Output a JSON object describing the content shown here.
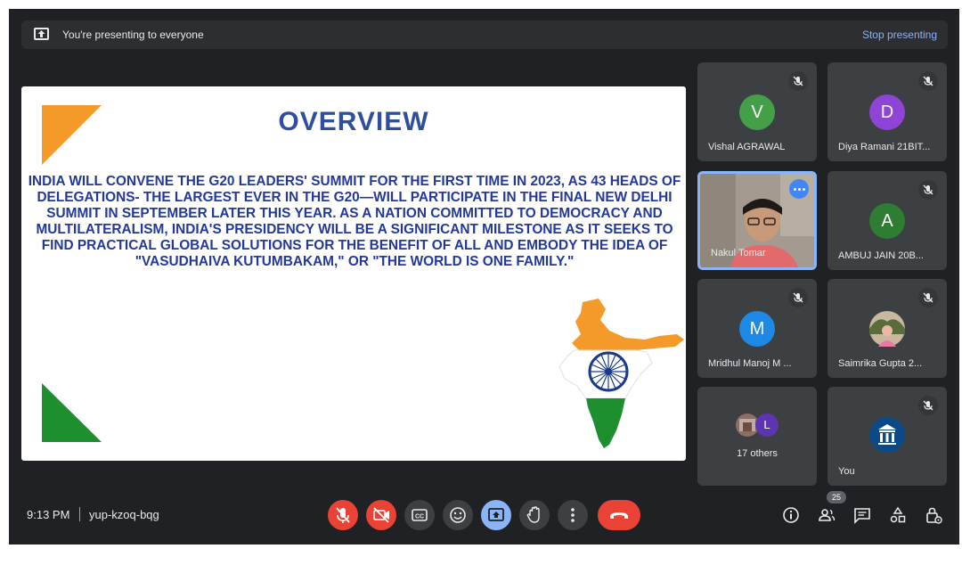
{
  "banner": {
    "text": "You're presenting to everyone",
    "stop_label": "Stop presenting",
    "icon": "present-icon"
  },
  "slide": {
    "title": "OVERVIEW",
    "body": "INDIA WILL CONVENE THE G20 LEADERS' SUMMIT FOR THE FIRST TIME IN 2023, AS 43 HEADS OF DELEGATIONS- THE LARGEST EVER IN THE G20—WILL PARTICIPATE IN THE FINAL NEW DELHI SUMMIT IN SEPTEMBER LATER THIS YEAR. AS A NATION COMMITTED TO DEMOCRACY AND MULTILATERALISM, INDIA'S PRESIDENCY WILL BE A SIGNIFICANT MILESTONE AS IT SEEKS TO FIND PRACTICAL GLOBAL SOLUTIONS FOR THE BENEFIT OF ALL AND EMBODY THE IDEA OF \"VASUDHAIVA KUTUMBAKAM,\" OR \"THE WORLD IS ONE FAMILY.\""
  },
  "participants": [
    {
      "name": "Vishal AGRAWAL",
      "initial": "V",
      "color": "#43a047",
      "muted": true
    },
    {
      "name": "Diya Ramani 21BIT...",
      "initial": "D",
      "color": "#8e44d4",
      "muted": true
    },
    {
      "name": "Nakul Tomar",
      "initial": "",
      "color": "#8ab4f8",
      "muted": false
    },
    {
      "name": "AMBUJ JAIN 20B...",
      "initial": "A",
      "color": "#2e7d32",
      "muted": true
    },
    {
      "name": "Mridhul Manoj M ...",
      "initial": "M",
      "color": "#1e88e5",
      "muted": true
    },
    {
      "name": "Saimrika Gupta 2...",
      "initial": "",
      "color": "#9aa0a6",
      "muted": true
    },
    {
      "name": "17 others",
      "initial": "L",
      "color": "#5e35b1",
      "muted": false
    },
    {
      "name": "You",
      "initial": "",
      "color": "#0b4a86",
      "muted": true
    }
  ],
  "bottom": {
    "time": "9:13 PM",
    "meeting_code": "yup-kzoq-bqg",
    "participant_count": "25"
  },
  "colors": {
    "accent": "#8ab4f8",
    "danger": "#ea4335",
    "tile": "#3c4043",
    "saffron": "#f39a2b",
    "green": "#1e8f2e"
  }
}
